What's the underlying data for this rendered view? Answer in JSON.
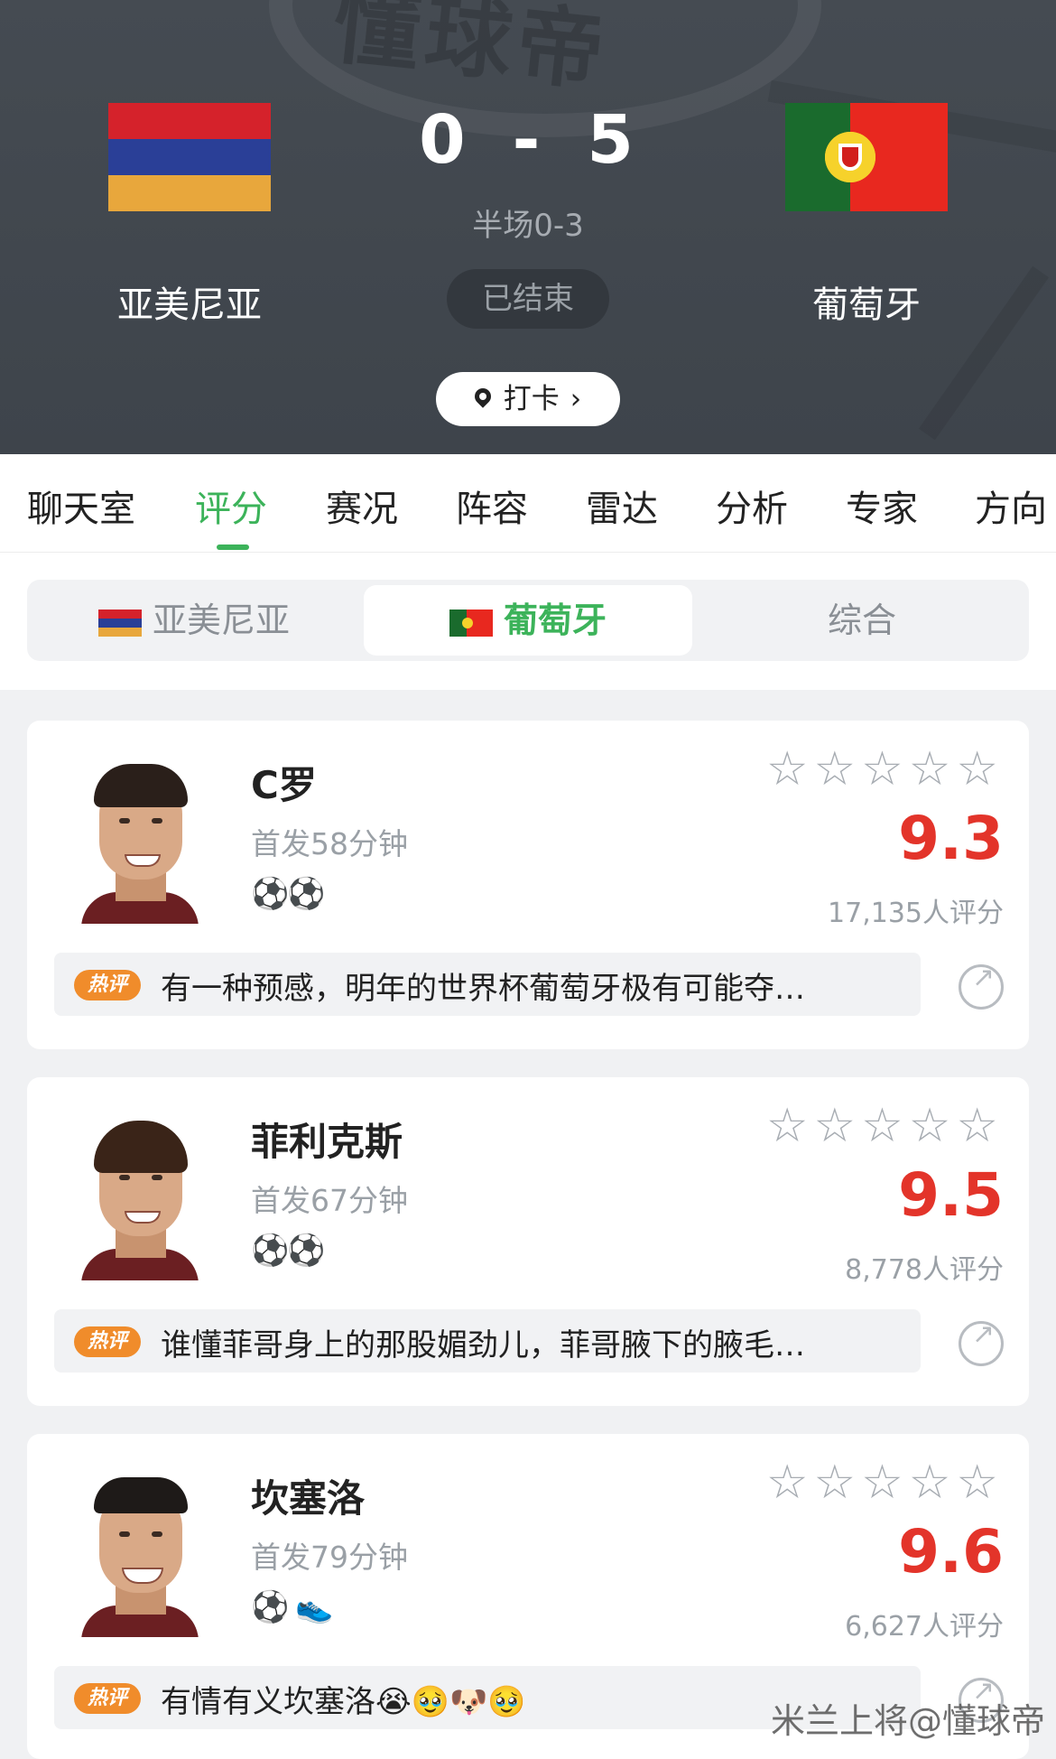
{
  "header": {
    "score_home": "0",
    "score_sep": "-",
    "score_away": "5",
    "half_time": "半场0-3",
    "status": "已结束",
    "home_team": "亚美尼亚",
    "away_team": "葡萄牙",
    "checkin_label": "打卡",
    "home_flag_colors": [
      "#d5222b",
      "#2a3f97",
      "#e8a73c"
    ],
    "away_flag_colors": [
      "#1a6b2d",
      "#e8281f",
      "#f6d22b"
    ]
  },
  "tabs": [
    {
      "label": "聊天室"
    },
    {
      "label": "评分",
      "active": true
    },
    {
      "label": "赛况"
    },
    {
      "label": "阵容"
    },
    {
      "label": "雷达"
    },
    {
      "label": "分析"
    },
    {
      "label": "专家"
    },
    {
      "label": "方向"
    }
  ],
  "segment": {
    "home": "亚美尼亚",
    "away": "葡萄牙",
    "overall": "综合",
    "selected": "葡萄牙"
  },
  "players": [
    {
      "name": "C罗",
      "minutes": "首发58分钟",
      "events": "⚽⚽",
      "rating": "9.3",
      "votes": "17,135人评分",
      "hot_tag": "热评",
      "comment": "有一种预感，明年的世界杯葡萄牙极有可能夺…"
    },
    {
      "name": "菲利克斯",
      "minutes": "首发67分钟",
      "events": "⚽⚽",
      "rating": "9.5",
      "votes": "8,778人评分",
      "hot_tag": "热评",
      "comment": "谁懂菲哥身上的那股媚劲儿，菲哥腋下的腋毛…"
    },
    {
      "name": "坎塞洛",
      "minutes": "首发79分钟",
      "events": "⚽ 👟",
      "rating": "9.6",
      "votes": "6,627人评分",
      "hot_tag": "热评",
      "comment": "有情有义坎塞洛😭🥹🐶🥹"
    }
  ],
  "stars": "☆☆☆☆☆",
  "accent_color": "#3cb35a",
  "rating_color": "#e3342a",
  "watermark": "米兰上将@懂球帝"
}
